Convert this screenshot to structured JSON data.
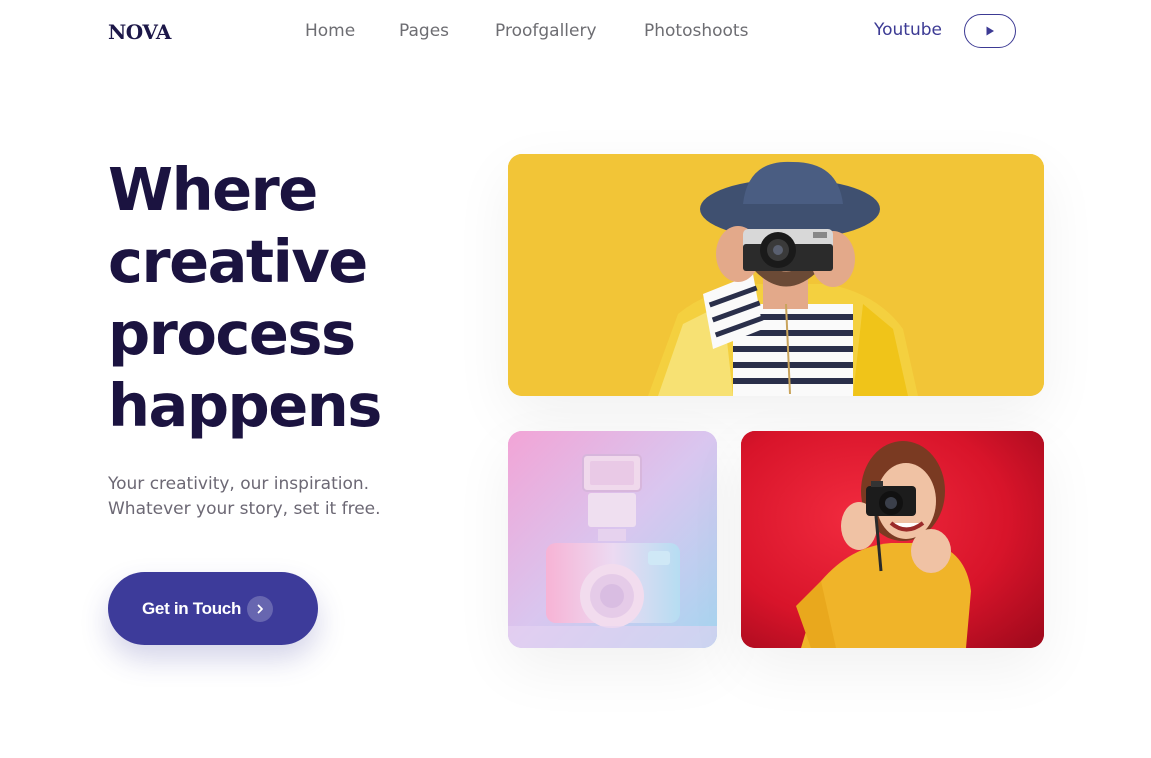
{
  "header": {
    "logo": "NOVA",
    "nav": [
      "Home",
      "Pages",
      "Proofgallery",
      "Photoshoots"
    ],
    "youtube_label": "Youtube",
    "play_icon": "play-icon"
  },
  "hero": {
    "title_lines": [
      "Where",
      "creative",
      "process",
      "happens"
    ],
    "subtitle_lines": [
      "Your creativity, our inspiration.",
      "Whatever your story, set it free."
    ],
    "cta_label": "Get in Touch",
    "cta_icon": "chevron-right-icon"
  },
  "colors": {
    "brand": "#3d3b9a",
    "title": "#1b1340",
    "photo_yellow_bg": "#f2c537",
    "photo_red_bg": "#d9142b"
  }
}
